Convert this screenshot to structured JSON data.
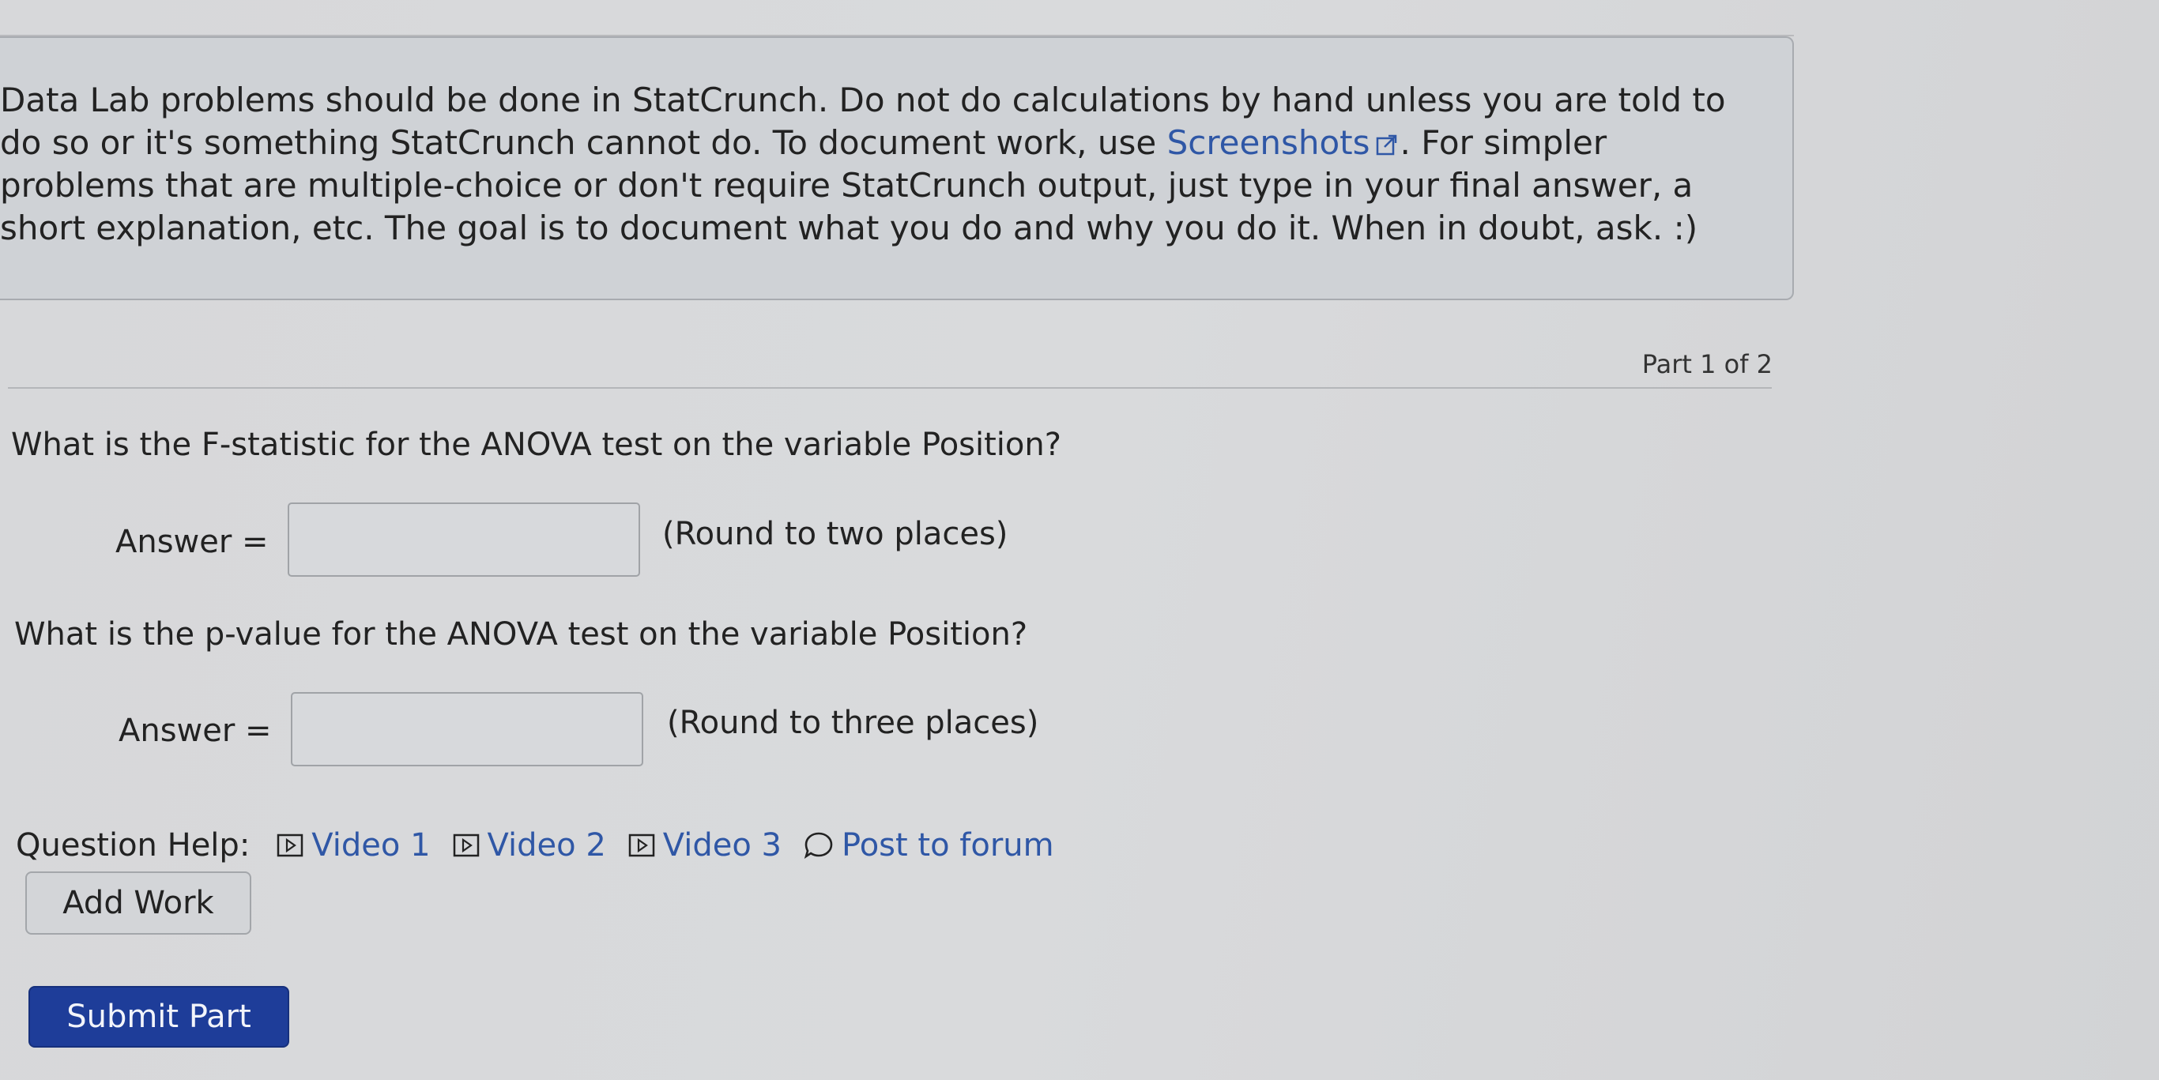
{
  "instructions": {
    "text_before_link": "Data Lab problems should be done in StatCrunch. Do not do calculations by hand unless you are told to do so or it's something StatCrunch cannot do. To document work, use ",
    "link_text": "Screenshots",
    "text_after_link": ". For simpler problems that are multiple-choice or don't require StatCrunch output, just type in your final answer, a short explanation, etc. The goal is to document what you do and why you do it. When in doubt, ask. :)"
  },
  "part": {
    "label": "Part 1 of 2"
  },
  "questions": [
    {
      "prompt": "What is the F-statistic for the ANOVA test on the variable Position?",
      "answer_label": "Answer =",
      "answer_value": "",
      "note": "(Round to two places)"
    },
    {
      "prompt": "What is the p-value for the ANOVA test on the variable Position?",
      "answer_label": "Answer =",
      "answer_value": "",
      "note": "(Round to three places)"
    }
  ],
  "help": {
    "label": "Question Help:",
    "links": [
      {
        "label": "Video 1",
        "icon": "play-icon"
      },
      {
        "label": "Video 2",
        "icon": "play-icon"
      },
      {
        "label": "Video 3",
        "icon": "play-icon"
      },
      {
        "label": "Post to forum",
        "icon": "speech-bubble-icon"
      }
    ]
  },
  "buttons": {
    "add_work": "Add Work",
    "submit": "Submit Part"
  },
  "colors": {
    "link": "#2f57a6",
    "submit_bg": "#1e3d99"
  }
}
